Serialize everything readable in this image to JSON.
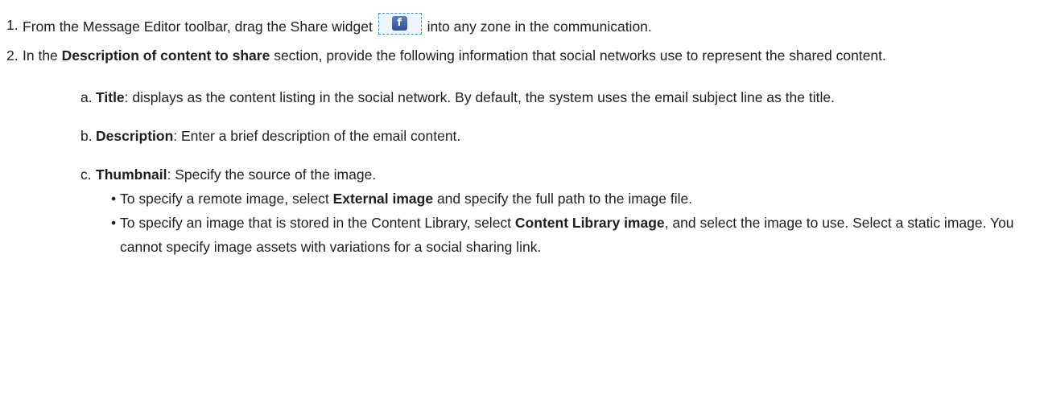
{
  "steps": [
    {
      "number": "1.",
      "pre": "From the Message Editor toolbar, drag the Share widget",
      "post": "into any zone in the communication."
    },
    {
      "number": "2.",
      "pre": "In the",
      "bold": "Description of content to share",
      "post": "section, provide the following information that social networks use to represent the shared content."
    }
  ],
  "widget": {
    "icon": "facebook-share-icon",
    "glyph": "f",
    "border_color": "#3f8fd8",
    "fill_color": "#3b5998"
  },
  "substeps": [
    {
      "letter": "a.",
      "bold": "Title",
      "text": ": displays as the content listing in the social network. By default, the system uses the email subject line as the title."
    },
    {
      "letter": "b.",
      "bold": "Description",
      "text": ": Enter a brief description of the email content."
    },
    {
      "letter": "c.",
      "bold": "Thumbnail",
      "text": ": Specify the source of the image."
    }
  ],
  "bullets": [
    {
      "marker": "•",
      "pre": "To specify a remote image, select",
      "bold": "External image",
      "post": "and specify the full path to the image file."
    },
    {
      "marker": "•",
      "pre": "To specify an image that is stored in the Content Library, select",
      "bold": "Content Library image",
      "post": ", and select the image to use. Select a static image. You cannot specify image assets with variations for a social sharing link."
    }
  ]
}
